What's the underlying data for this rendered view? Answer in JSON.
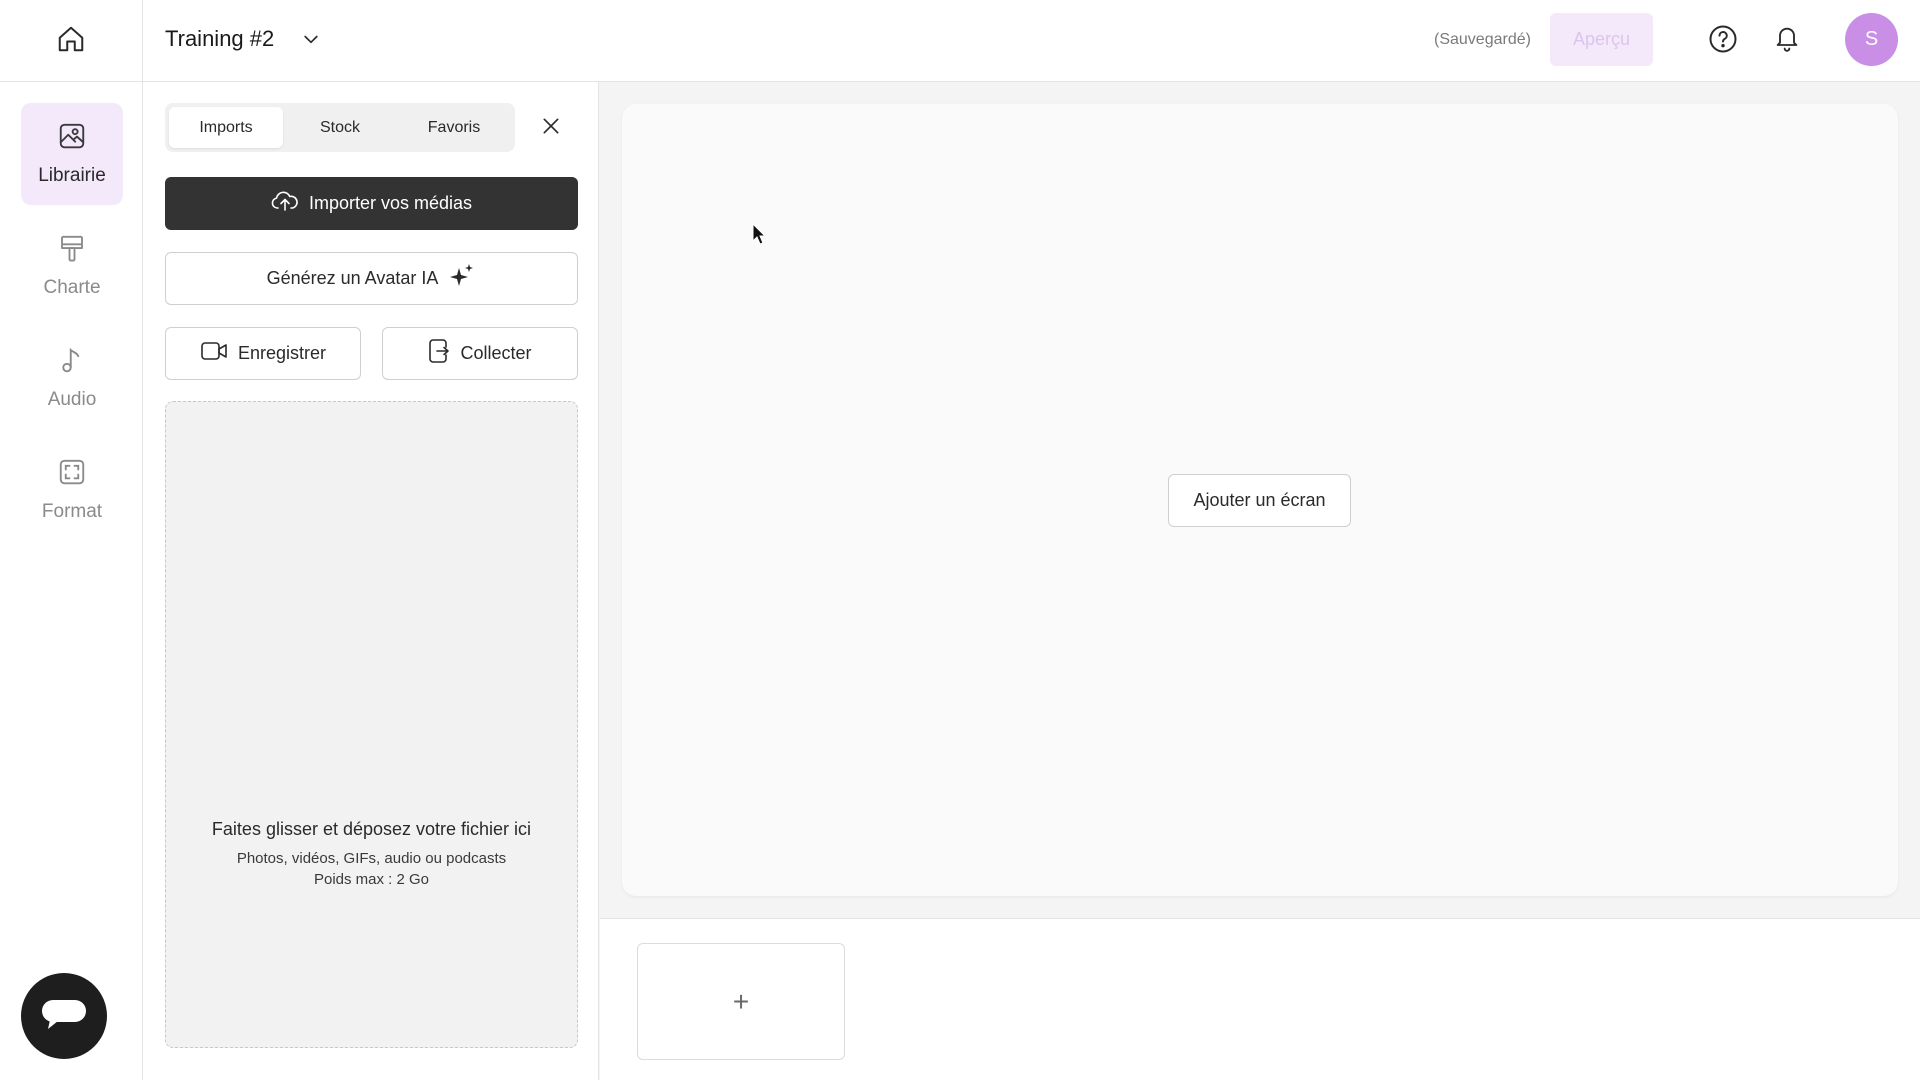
{
  "header": {
    "project_title": "Training #2",
    "save_status": "(Sauvegardé)",
    "preview_label": "Aperçu",
    "avatar_initial": "S",
    "icons": [
      "home-icon",
      "chevron-down-icon",
      "help-icon",
      "bell-icon"
    ]
  },
  "sidebar": {
    "items": [
      {
        "label": "Librairie",
        "icon": "image-icon",
        "active": true
      },
      {
        "label": "Charte",
        "icon": "paint-roller-icon",
        "active": false
      },
      {
        "label": "Audio",
        "icon": "music-note-icon",
        "active": false
      },
      {
        "label": "Format",
        "icon": "frame-icon",
        "active": false
      }
    ],
    "chat_icon": "chat-bubble-icon"
  },
  "panel": {
    "tabs": [
      {
        "label": "Imports",
        "active": true
      },
      {
        "label": "Stock",
        "active": false
      },
      {
        "label": "Favoris",
        "active": false
      }
    ],
    "import_label": "Importer vos médias",
    "avatar_label": "Générez un Avatar IA",
    "record_label": "Enregistrer",
    "collect_label": "Collecter",
    "dropzone": {
      "title": "Faites glisser et déposez votre fichier ici",
      "formats": "Photos, vidéos, GIFs, audio ou podcasts",
      "max_size": "Poids max : 2 Go"
    }
  },
  "canvas": {
    "add_screen_label": "Ajouter un écran"
  },
  "timeline": {
    "add_symbol": "+"
  },
  "colors": {
    "accent": "#c98ee6",
    "accent_light": "#f4e8fb",
    "dark_button": "#333333",
    "chat_bubble": "#1e1e1e"
  }
}
